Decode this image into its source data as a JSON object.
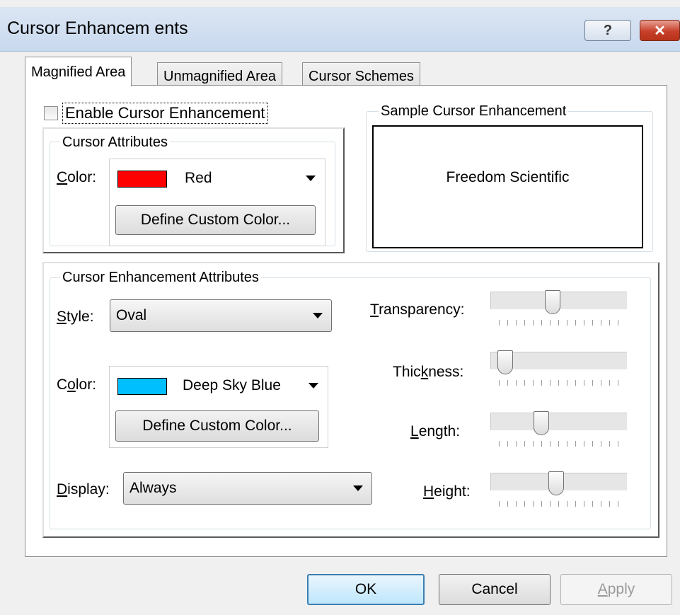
{
  "window": {
    "title": "Cursor Enhancem ents",
    "help_label": "?",
    "close_label": "✕"
  },
  "tabs": [
    {
      "label": "Magnified Area",
      "active": true
    },
    {
      "label": "Unmagnified Area",
      "active": false
    },
    {
      "label": "Cursor Schemes",
      "active": false
    }
  ],
  "enable": {
    "label": "Enable Cursor Enhancement",
    "checked": false
  },
  "cursor_attributes": {
    "legend": "Cursor Attributes",
    "color_label": "Color:",
    "color_value": "Red",
    "color_hex": "#ff0000",
    "define_button": "Define Custom Color..."
  },
  "sample": {
    "legend": "Sample Cursor Enhancement",
    "text": "Freedom  Scientific"
  },
  "enhancement_attributes": {
    "legend": "Cursor Enhancement Attributes",
    "style_label": "Style:",
    "style_value": "Oval",
    "color_label": "Color:",
    "color_value": "Deep Sky Blue",
    "color_hex": "#00bfff",
    "define_button": "Define Custom Color...",
    "display_label": "Display:",
    "display_value": "Always",
    "sliders": [
      {
        "label": "Transparency:",
        "level": 0.42
      },
      {
        "label": "Thickness:",
        "level": 0.0
      },
      {
        "label": "Length:",
        "level": 0.32
      },
      {
        "label": "Height:",
        "level": 0.45
      }
    ]
  },
  "buttons": {
    "ok": "OK",
    "cancel": "Cancel",
    "apply": "Apply"
  }
}
